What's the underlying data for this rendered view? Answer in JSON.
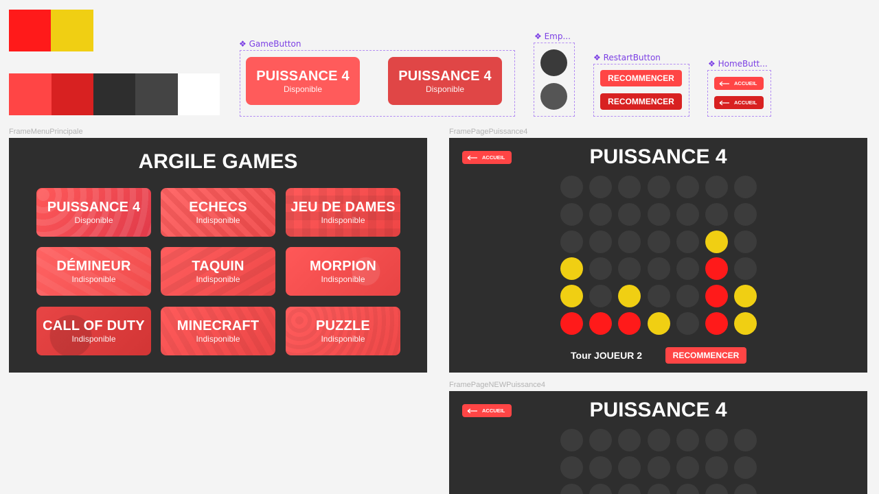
{
  "colors": {
    "red_bright": "#ff1a1a",
    "yellow": "#f0cf13",
    "red_light": "#ff4545",
    "red_dark": "#d82121",
    "gray_dark": "#2e2e2e",
    "gray_mid": "#444444",
    "white": "#ffffff",
    "empty_cell": "#3c3c3c",
    "empty_cell_alt": "#5a5a5a",
    "component_purple": "#7b3fe4"
  },
  "components": {
    "game_button": {
      "label": "❖ GameButton",
      "title": "PUISSANCE 4",
      "subtitle": "Disponible"
    },
    "empty": {
      "label": "❖ Emp..."
    },
    "restart_button": {
      "label": "❖ RestartButton",
      "text": "RECOMMENCER"
    },
    "home_button": {
      "label": "❖ HomeButt...",
      "text": "ACCUEIL"
    }
  },
  "menu_frame": {
    "frame_name": "FrameMenuPrincipale",
    "title": "ARGILE GAMES",
    "games": [
      {
        "title": "PUISSANCE 4",
        "status": "Disponible"
      },
      {
        "title": "ECHECS",
        "status": "Indisponible"
      },
      {
        "title": "JEU DE DAMES",
        "status": "Indisponible"
      },
      {
        "title": "DÉMINEUR",
        "status": "Indisponible"
      },
      {
        "title": "TAQUIN",
        "status": "Indisponible"
      },
      {
        "title": "MORPION",
        "status": "Indisponible"
      },
      {
        "title": "CALL OF DUTY",
        "status": "Indisponible"
      },
      {
        "title": "MINECRAFT",
        "status": "Indisponible"
      },
      {
        "title": "PUZZLE",
        "status": "Indisponible"
      }
    ]
  },
  "p4_frame": {
    "frame_name": "FramePagePuissance4",
    "title": "PUISSANCE 4",
    "home_text": "ACCUEIL",
    "turn_text": "Tour JOUEUR 2",
    "restart_text": "RECOMMENCER",
    "board": [
      [
        "e",
        "e",
        "e",
        "e",
        "e",
        "e",
        "e"
      ],
      [
        "e",
        "e",
        "e",
        "e",
        "e",
        "e",
        "e"
      ],
      [
        "e",
        "e",
        "e",
        "e",
        "e",
        "Y",
        "e"
      ],
      [
        "Y",
        "e",
        "e",
        "e",
        "e",
        "R",
        "e"
      ],
      [
        "Y",
        "e",
        "Y",
        "e",
        "e",
        "R",
        "Y"
      ],
      [
        "R",
        "R",
        "R",
        "Y",
        "e",
        "R",
        "Y"
      ]
    ]
  },
  "new_p4_frame": {
    "frame_name": "FramePageNEWPuissance4",
    "title": "PUISSANCE 4",
    "home_text": "ACCUEIL",
    "board": [
      [
        "e",
        "e",
        "e",
        "e",
        "e",
        "e",
        "e"
      ],
      [
        "e",
        "e",
        "e",
        "e",
        "e",
        "e",
        "e"
      ],
      [
        "e",
        "e",
        "e",
        "e",
        "e",
        "e",
        "e"
      ]
    ]
  }
}
